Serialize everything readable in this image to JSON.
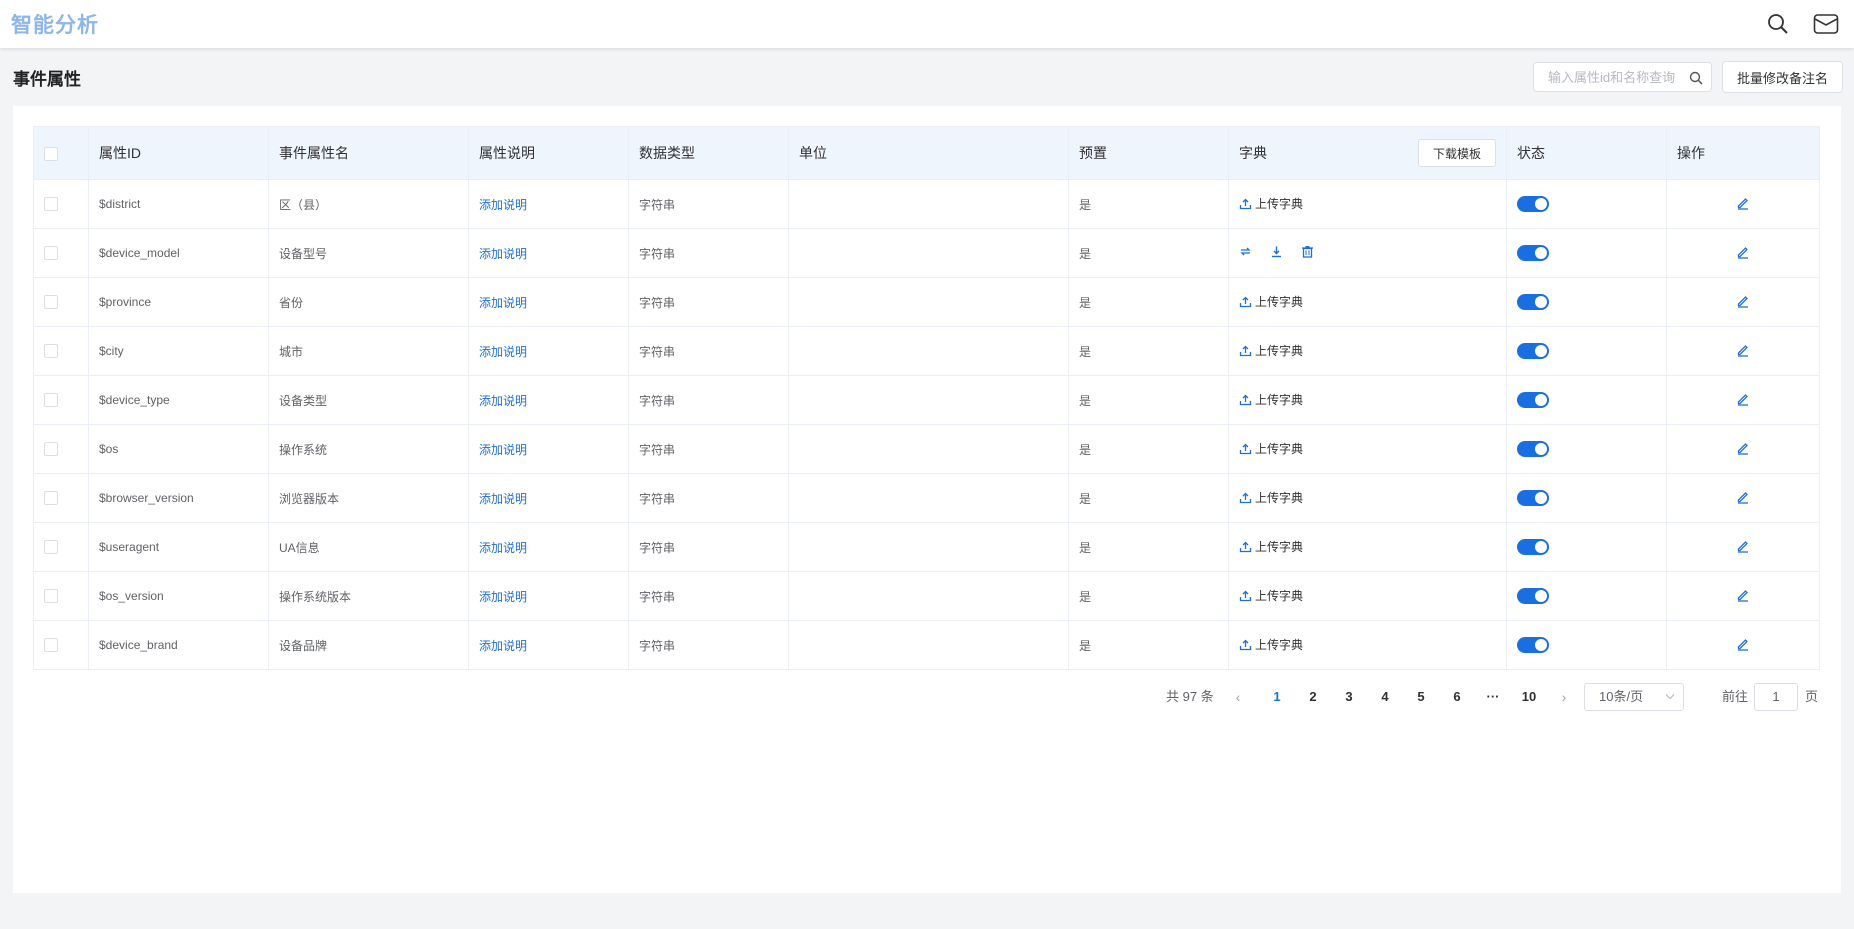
{
  "app": {
    "title": "智能分析"
  },
  "header": {
    "icons": [
      "search-icon",
      "mail-icon"
    ]
  },
  "page": {
    "title": "事件属性",
    "search_placeholder": "输入属性id和名称查询",
    "batch_button": "批量修改备注名"
  },
  "table": {
    "columns": {
      "id": "属性ID",
      "name": "事件属性名",
      "desc": "属性说明",
      "type": "数据类型",
      "unit": "单位",
      "preset": "预置",
      "dict": "字典",
      "status": "状态",
      "op": "操作"
    },
    "template_button": "下载模板",
    "rows": [
      {
        "id": "$district",
        "name": "区（县）",
        "desc": "添加说明",
        "type": "字符串",
        "unit": "",
        "preset": "是",
        "dict": "上传字典",
        "has_dict": false,
        "enabled": true
      },
      {
        "id": "$device_model",
        "name": "设备型号",
        "desc": "添加说明",
        "type": "字符串",
        "unit": "",
        "preset": "是",
        "dict": "",
        "has_dict": true,
        "enabled": true
      },
      {
        "id": "$province",
        "name": "省份",
        "desc": "添加说明",
        "type": "字符串",
        "unit": "",
        "preset": "是",
        "dict": "上传字典",
        "has_dict": false,
        "enabled": true
      },
      {
        "id": "$city",
        "name": "城市",
        "desc": "添加说明",
        "type": "字符串",
        "unit": "",
        "preset": "是",
        "dict": "上传字典",
        "has_dict": false,
        "enabled": true
      },
      {
        "id": "$device_type",
        "name": "设备类型",
        "desc": "添加说明",
        "type": "字符串",
        "unit": "",
        "preset": "是",
        "dict": "上传字典",
        "has_dict": false,
        "enabled": true
      },
      {
        "id": "$os",
        "name": "操作系统",
        "desc": "添加说明",
        "type": "字符串",
        "unit": "",
        "preset": "是",
        "dict": "上传字典",
        "has_dict": false,
        "enabled": true
      },
      {
        "id": "$browser_version",
        "name": "浏览器版本",
        "desc": "添加说明",
        "type": "字符串",
        "unit": "",
        "preset": "是",
        "dict": "上传字典",
        "has_dict": false,
        "enabled": true
      },
      {
        "id": "$useragent",
        "name": "UA信息",
        "desc": "添加说明",
        "type": "字符串",
        "unit": "",
        "preset": "是",
        "dict": "上传字典",
        "has_dict": false,
        "enabled": true
      },
      {
        "id": "$os_version",
        "name": "操作系统版本",
        "desc": "添加说明",
        "type": "字符串",
        "unit": "",
        "preset": "是",
        "dict": "上传字典",
        "has_dict": false,
        "enabled": true
      },
      {
        "id": "$device_brand",
        "name": "设备品牌",
        "desc": "添加说明",
        "type": "字符串",
        "unit": "",
        "preset": "是",
        "dict": "上传字典",
        "has_dict": false,
        "enabled": true
      }
    ]
  },
  "pagination": {
    "total": "共 97 条",
    "pages": [
      "1",
      "2",
      "3",
      "4",
      "5",
      "6",
      "···",
      "10"
    ],
    "current": "1",
    "page_size": "10条/页",
    "goto_label": "前往",
    "goto_value": "1",
    "goto_suffix": "页"
  },
  "colors": {
    "accent": "#1f6fd8",
    "brand": "#8eb6ea",
    "header_bg": "#eef5fd"
  }
}
